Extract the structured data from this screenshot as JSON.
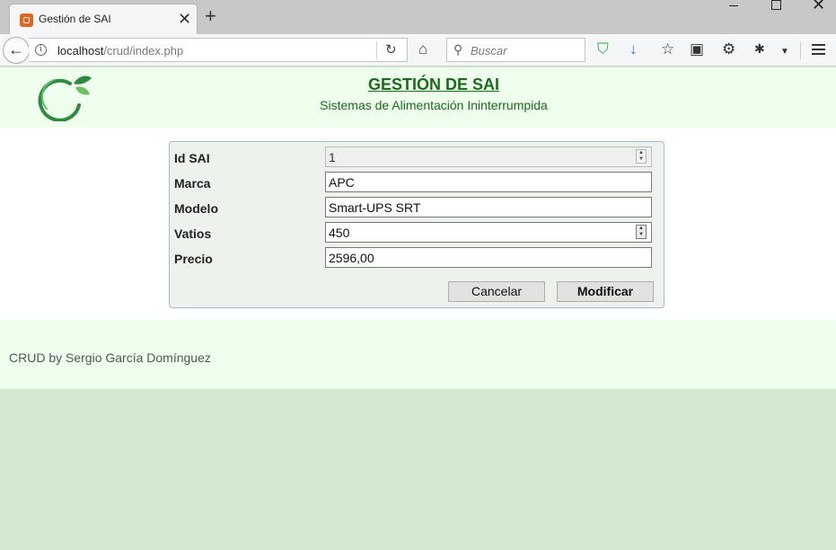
{
  "browser": {
    "tab_title": "Gestión de SAI",
    "url_host": "localhost",
    "url_path": "/crud/index.php",
    "search_placeholder": "Buscar",
    "icons": [
      "back-arrow-icon",
      "info-icon",
      "reload-icon",
      "home-icon",
      "search-icon",
      "shield-icon",
      "download-icon",
      "star-icon",
      "clipboard-icon",
      "gear-icon",
      "extension-icon",
      "menu-icon"
    ]
  },
  "header": {
    "title": "GESTIÓN DE SAI",
    "subtitle": "Sistemas de Alimentación Ininterrumpida"
  },
  "form": {
    "fields": [
      {
        "label": "Id SAI",
        "value": "1",
        "readonly": true
      },
      {
        "label": "Marca",
        "value": "APC"
      },
      {
        "label": "Modelo",
        "value": "Smart-UPS SRT"
      },
      {
        "label": "Vatios",
        "value": "450"
      },
      {
        "label": "Precio",
        "value": "2596,00"
      }
    ],
    "cancel_label": "Cancelar",
    "submit_label": "Modificar"
  },
  "footer": {
    "text": "CRUD by Sergio García Domínguez"
  },
  "colors": {
    "header_bg": "#efffee",
    "title_green": "#1a6b1a",
    "page_bg": "#d2e8cf",
    "form_bg": "#eef2ec",
    "form_border": "#a8b4d8"
  }
}
